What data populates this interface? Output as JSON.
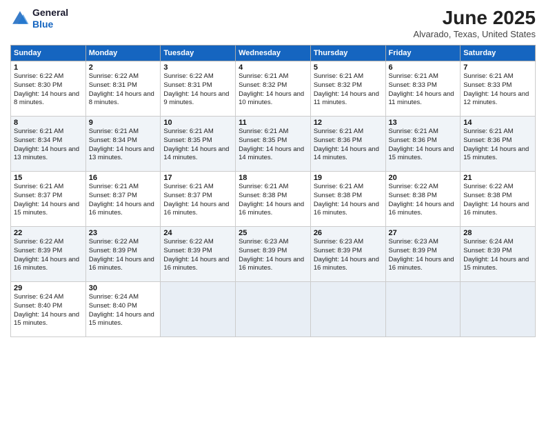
{
  "header": {
    "logo_line1": "General",
    "logo_line2": "Blue",
    "month": "June 2025",
    "location": "Alvarado, Texas, United States"
  },
  "weekdays": [
    "Sunday",
    "Monday",
    "Tuesday",
    "Wednesday",
    "Thursday",
    "Friday",
    "Saturday"
  ],
  "weeks": [
    [
      {
        "day": "1",
        "sunrise": "6:22 AM",
        "sunset": "8:30 PM",
        "daylight": "14 hours and 8 minutes."
      },
      {
        "day": "2",
        "sunrise": "6:22 AM",
        "sunset": "8:31 PM",
        "daylight": "14 hours and 8 minutes."
      },
      {
        "day": "3",
        "sunrise": "6:22 AM",
        "sunset": "8:31 PM",
        "daylight": "14 hours and 9 minutes."
      },
      {
        "day": "4",
        "sunrise": "6:21 AM",
        "sunset": "8:32 PM",
        "daylight": "14 hours and 10 minutes."
      },
      {
        "day": "5",
        "sunrise": "6:21 AM",
        "sunset": "8:32 PM",
        "daylight": "14 hours and 11 minutes."
      },
      {
        "day": "6",
        "sunrise": "6:21 AM",
        "sunset": "8:33 PM",
        "daylight": "14 hours and 11 minutes."
      },
      {
        "day": "7",
        "sunrise": "6:21 AM",
        "sunset": "8:33 PM",
        "daylight": "14 hours and 12 minutes."
      }
    ],
    [
      {
        "day": "8",
        "sunrise": "6:21 AM",
        "sunset": "8:34 PM",
        "daylight": "14 hours and 13 minutes."
      },
      {
        "day": "9",
        "sunrise": "6:21 AM",
        "sunset": "8:34 PM",
        "daylight": "14 hours and 13 minutes."
      },
      {
        "day": "10",
        "sunrise": "6:21 AM",
        "sunset": "8:35 PM",
        "daylight": "14 hours and 14 minutes."
      },
      {
        "day": "11",
        "sunrise": "6:21 AM",
        "sunset": "8:35 PM",
        "daylight": "14 hours and 14 minutes."
      },
      {
        "day": "12",
        "sunrise": "6:21 AM",
        "sunset": "8:36 PM",
        "daylight": "14 hours and 14 minutes."
      },
      {
        "day": "13",
        "sunrise": "6:21 AM",
        "sunset": "8:36 PM",
        "daylight": "14 hours and 15 minutes."
      },
      {
        "day": "14",
        "sunrise": "6:21 AM",
        "sunset": "8:36 PM",
        "daylight": "14 hours and 15 minutes."
      }
    ],
    [
      {
        "day": "15",
        "sunrise": "6:21 AM",
        "sunset": "8:37 PM",
        "daylight": "14 hours and 15 minutes."
      },
      {
        "day": "16",
        "sunrise": "6:21 AM",
        "sunset": "8:37 PM",
        "daylight": "14 hours and 16 minutes."
      },
      {
        "day": "17",
        "sunrise": "6:21 AM",
        "sunset": "8:37 PM",
        "daylight": "14 hours and 16 minutes."
      },
      {
        "day": "18",
        "sunrise": "6:21 AM",
        "sunset": "8:38 PM",
        "daylight": "14 hours and 16 minutes."
      },
      {
        "day": "19",
        "sunrise": "6:21 AM",
        "sunset": "8:38 PM",
        "daylight": "14 hours and 16 minutes."
      },
      {
        "day": "20",
        "sunrise": "6:22 AM",
        "sunset": "8:38 PM",
        "daylight": "14 hours and 16 minutes."
      },
      {
        "day": "21",
        "sunrise": "6:22 AM",
        "sunset": "8:38 PM",
        "daylight": "14 hours and 16 minutes."
      }
    ],
    [
      {
        "day": "22",
        "sunrise": "6:22 AM",
        "sunset": "8:39 PM",
        "daylight": "14 hours and 16 minutes."
      },
      {
        "day": "23",
        "sunrise": "6:22 AM",
        "sunset": "8:39 PM",
        "daylight": "14 hours and 16 minutes."
      },
      {
        "day": "24",
        "sunrise": "6:22 AM",
        "sunset": "8:39 PM",
        "daylight": "14 hours and 16 minutes."
      },
      {
        "day": "25",
        "sunrise": "6:23 AM",
        "sunset": "8:39 PM",
        "daylight": "14 hours and 16 minutes."
      },
      {
        "day": "26",
        "sunrise": "6:23 AM",
        "sunset": "8:39 PM",
        "daylight": "14 hours and 16 minutes."
      },
      {
        "day": "27",
        "sunrise": "6:23 AM",
        "sunset": "8:39 PM",
        "daylight": "14 hours and 16 minutes."
      },
      {
        "day": "28",
        "sunrise": "6:24 AM",
        "sunset": "8:39 PM",
        "daylight": "14 hours and 15 minutes."
      }
    ],
    [
      {
        "day": "29",
        "sunrise": "6:24 AM",
        "sunset": "8:40 PM",
        "daylight": "14 hours and 15 minutes."
      },
      {
        "day": "30",
        "sunrise": "6:24 AM",
        "sunset": "8:40 PM",
        "daylight": "14 hours and 15 minutes."
      },
      {
        "day": "",
        "sunrise": "",
        "sunset": "",
        "daylight": ""
      },
      {
        "day": "",
        "sunrise": "",
        "sunset": "",
        "daylight": ""
      },
      {
        "day": "",
        "sunrise": "",
        "sunset": "",
        "daylight": ""
      },
      {
        "day": "",
        "sunrise": "",
        "sunset": "",
        "daylight": ""
      },
      {
        "day": "",
        "sunrise": "",
        "sunset": "",
        "daylight": ""
      }
    ]
  ]
}
